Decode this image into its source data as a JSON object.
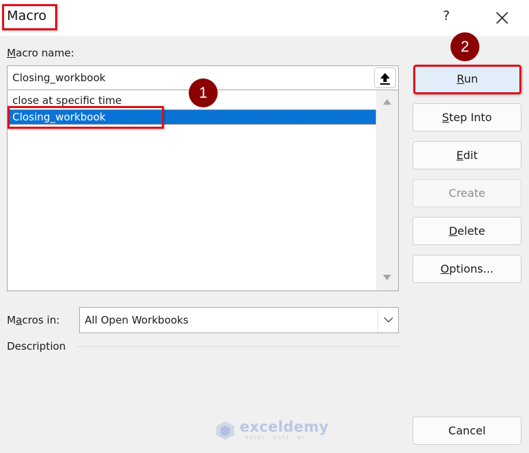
{
  "window": {
    "title": "Macro",
    "help_label": "?",
    "close_icon": "close-icon"
  },
  "macro_name": {
    "label_prefix": "",
    "label_mnemonic": "M",
    "label_rest": "acro name:",
    "value": "Closing_workbook",
    "collapse_icon": "upload-arrow-icon"
  },
  "macro_list": {
    "items": [
      {
        "label": "close at specific time",
        "selected": false
      },
      {
        "label": "Closing_workbook",
        "selected": true
      }
    ]
  },
  "buttons": {
    "run": {
      "mnemonic": "R",
      "rest": "un",
      "enabled": true
    },
    "step_into": {
      "mnemonic": "S",
      "rest": "tep Into",
      "enabled": true
    },
    "edit": {
      "mnemonic": "E",
      "rest": "dit",
      "enabled": true
    },
    "create": {
      "label": "Create",
      "enabled": false
    },
    "delete": {
      "mnemonic": "D",
      "rest": "elete",
      "enabled": true
    },
    "options": {
      "mnemonic": "O",
      "rest": "ptions...",
      "enabled": true
    },
    "cancel": {
      "label": "Cancel",
      "enabled": true
    }
  },
  "macros_in": {
    "label_pre": "M",
    "label_mnemonic": "a",
    "label_rest": "cros in:",
    "value": "All Open Workbooks"
  },
  "description": {
    "label": "Description",
    "text": ""
  },
  "annotations": {
    "step1": "1",
    "step2": "2",
    "highlight_color": "#e0101a",
    "badge_color": "#8b0000"
  },
  "watermark": {
    "brand": "exceldemy",
    "tagline": "EXCEL · DATA · BI"
  },
  "colors": {
    "selection": "#0a74d6",
    "run_button_bg": "#e1eef9",
    "dialog_bg": "#f0f0f0"
  }
}
